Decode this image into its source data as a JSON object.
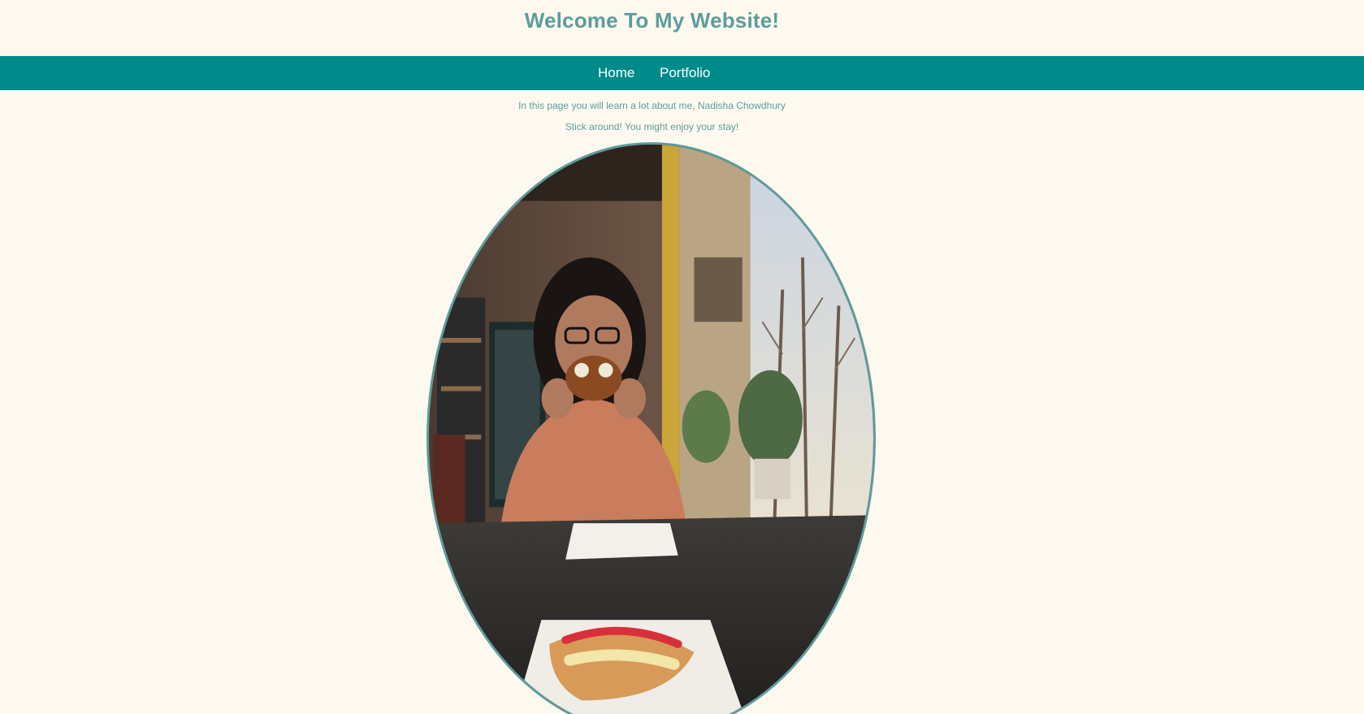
{
  "header": {
    "title": "Welcome To My Website!"
  },
  "nav": {
    "items": [
      {
        "label": "Home"
      },
      {
        "label": "Portfolio"
      }
    ]
  },
  "intro": {
    "line1": "In this page you will learn a lot about me, Nadisha Chowdhury",
    "line2": "Stick around! You might enjoy your stay!"
  },
  "photo": {
    "subject": "person eating a pastry at a cafe table"
  },
  "colors": {
    "background": "#fdf9ee",
    "accent": "#5d9c9c",
    "navbar": "#008b8b",
    "nav_text": "#ffffff"
  }
}
